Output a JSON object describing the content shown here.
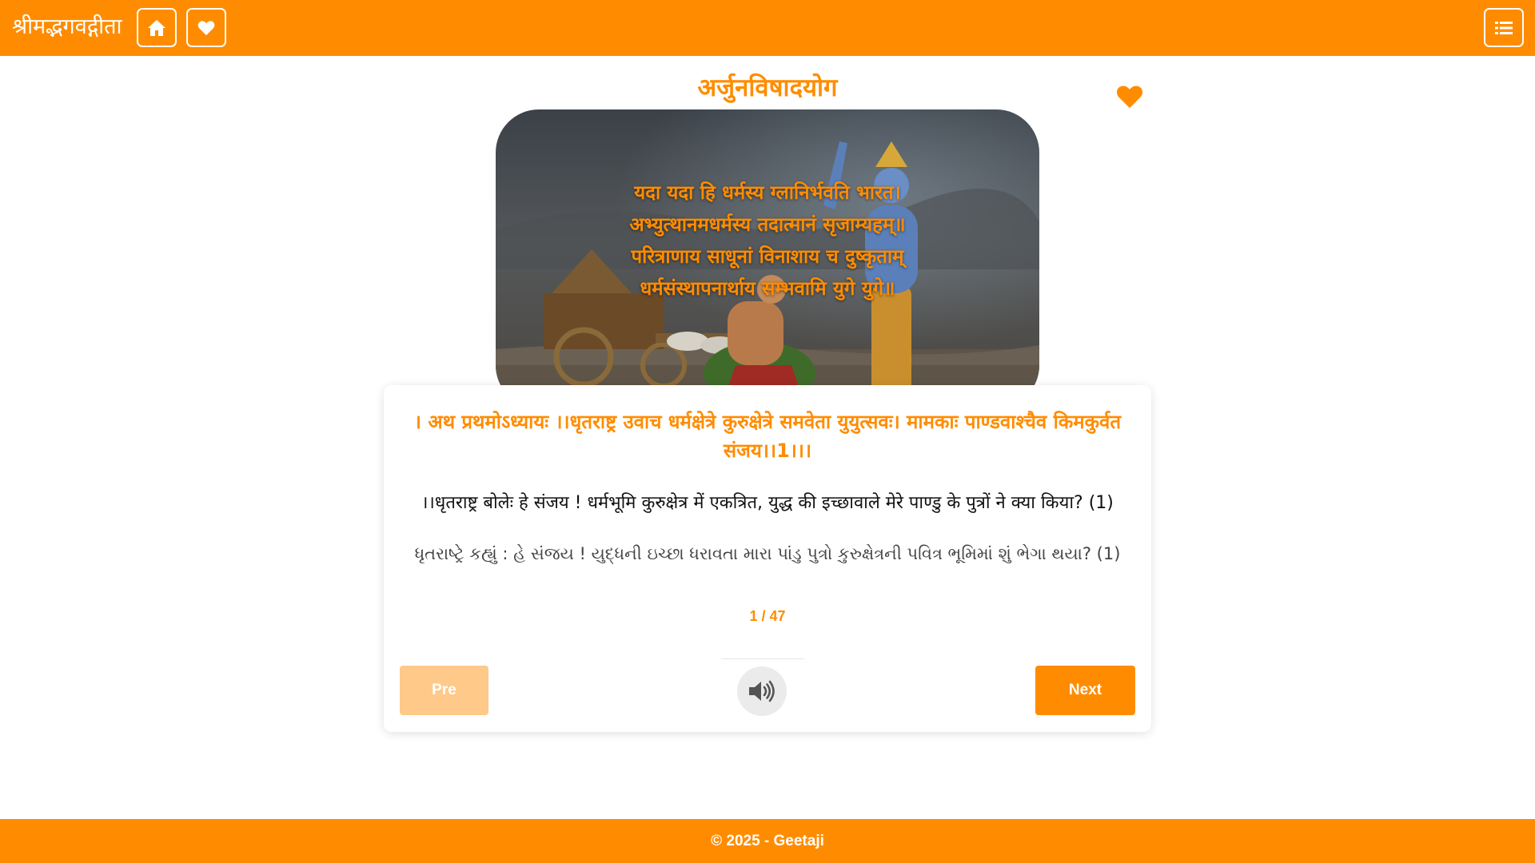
{
  "navbar": {
    "brand": "श्रीमद्भगवद्गीता",
    "icons": {
      "home": "home-icon",
      "favorites": "heart-icon",
      "menu": "list-icon"
    }
  },
  "chapter": {
    "title": "अर्जुनविषादयोग",
    "favorite_icon": "heart-icon"
  },
  "hero": {
    "lines": [
      "यदा यदा हि धर्मस्य ग्लानिर्भवति भारत।",
      "अभ्युत्थानमधर्मस्य तदात्मानं सृजाम्यहम्॥",
      "परित्राणाय साधूनां विनाशाय च दुष्कृताम्",
      "धर्मसंस्थापनार्थाय सम्भवामि युगे युगे॥"
    ]
  },
  "verse": {
    "shloka": "। अथ प्रथमोऽध्यायः ।।धृतराष्ट्र उवाच धर्मक्षेत्रे कुरुक्षेत्रे समवेता युयुत्सवः। मामकाः पाण्डवाश्चैव किमकुर्वत संजय।।1।।।",
    "hindi": "।।धृतराष्ट्र बोलेः हे संजय ! धर्मभूमि कुरुक्षेत्र में एकत्रित, युद्ध की इच्छावाले मेरे पाण्डु के पुत्रों ने क्या किया? (1)",
    "gujarati": "ધૃતરાષ્ટ્રે કહ્યું : હે સંજય ! યુદ્ધની ઇચ્છા ધરાવતા મારા પાંડુ પુત્રો કુરુક્ષેત્રની પવિત્ર ભૂમિમાં શું ભેગા થયા? (1)",
    "counter": "1 / 47"
  },
  "controls": {
    "pre_label": "Pre",
    "next_label": "Next",
    "audio_icon": "volume-icon"
  },
  "footer": {
    "text": "© 2025 - Geetaji"
  },
  "colors": {
    "accent": "#ff8c00",
    "accent_disabled": "#ffc98a",
    "text": "#111111"
  }
}
